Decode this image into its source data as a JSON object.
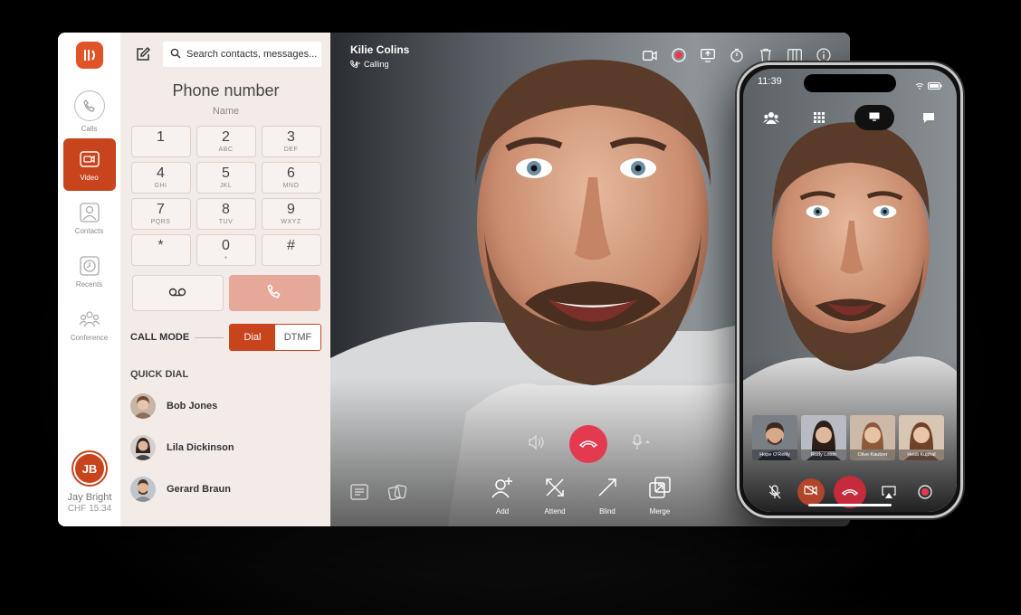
{
  "rail": {
    "items": [
      {
        "label": "Calls"
      },
      {
        "label": "Video"
      },
      {
        "label": "Contacts"
      },
      {
        "label": "Recents"
      },
      {
        "label": "Conference"
      }
    ],
    "user": {
      "initials": "JB",
      "name": "Jay Bright",
      "balance": "CHF 15.34"
    }
  },
  "dialer": {
    "search_placeholder": "Search contacts, messages...",
    "title": "Phone number",
    "subtitle": "Name",
    "keys": [
      {
        "digit": "1",
        "letters": ""
      },
      {
        "digit": "2",
        "letters": "ABC"
      },
      {
        "digit": "3",
        "letters": "DEF"
      },
      {
        "digit": "4",
        "letters": "GHI"
      },
      {
        "digit": "5",
        "letters": "JKL"
      },
      {
        "digit": "6",
        "letters": "MNO"
      },
      {
        "digit": "7",
        "letters": "PQRS"
      },
      {
        "digit": "8",
        "letters": "TUV"
      },
      {
        "digit": "9",
        "letters": "WXYZ"
      },
      {
        "digit": "*",
        "letters": ""
      },
      {
        "digit": "0",
        "letters": "+"
      },
      {
        "digit": "#",
        "letters": ""
      }
    ],
    "call_mode_label": "CALL MODE",
    "mode_dial": "Dial",
    "mode_dtmf": "DTMF",
    "quick_dial_label": "QUICK DIAL",
    "quick_dial": [
      {
        "name": "Bob Jones"
      },
      {
        "name": "Lila Dickinson"
      },
      {
        "name": "Gerard Braun"
      }
    ]
  },
  "call": {
    "caller_name": "Kilie Colins",
    "status": "Calling",
    "actions": [
      {
        "label": "Add"
      },
      {
        "label": "Attend"
      },
      {
        "label": "Blind"
      },
      {
        "label": "Merge"
      }
    ]
  },
  "phone": {
    "time": "11:39",
    "participants": [
      {
        "name": "Hope O'Reilly"
      },
      {
        "name": "Rudy Loton"
      },
      {
        "name": "Olive Kautzer"
      },
      {
        "name": "Heidi Kuphal"
      }
    ]
  },
  "colors": {
    "accent": "#c7441d",
    "hangup": "#e43a50",
    "panel": "#f3ebe8"
  }
}
